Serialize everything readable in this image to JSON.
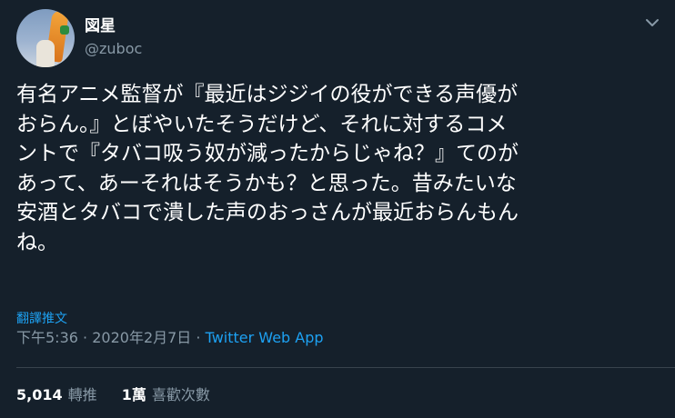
{
  "user": {
    "display_name": "図星",
    "handle": "@zuboc"
  },
  "tweet": {
    "text": "有名アニメ監督が『最近はジジイの役ができる声優が\nおらん。』とぼやいたそうだけど、それに対するコメ\nントで『タバコ吸う奴が減ったからじゃね？』てのが\nあって、あーそれはそうかも？と思った。昔みたいな\n安酒とタバコで潰した声のおっさんが最近おらんもん\nね。",
    "translate_label": "翻譯推文",
    "time": "下午5:36",
    "separator": "·",
    "date": "2020年2月7日",
    "app": "Twitter Web App"
  },
  "stats": {
    "retweets_count": "5,014",
    "retweets_label": "轉推",
    "likes_count": "1萬",
    "likes_label": "喜歡次數"
  },
  "icons": {
    "caret": "chevron-down-icon",
    "avatar": "user-avatar"
  },
  "colors": {
    "background": "#15202b",
    "text": "#ffffff",
    "secondary": "#8899a6",
    "accent": "#1da1f2",
    "divider": "#38444d"
  }
}
